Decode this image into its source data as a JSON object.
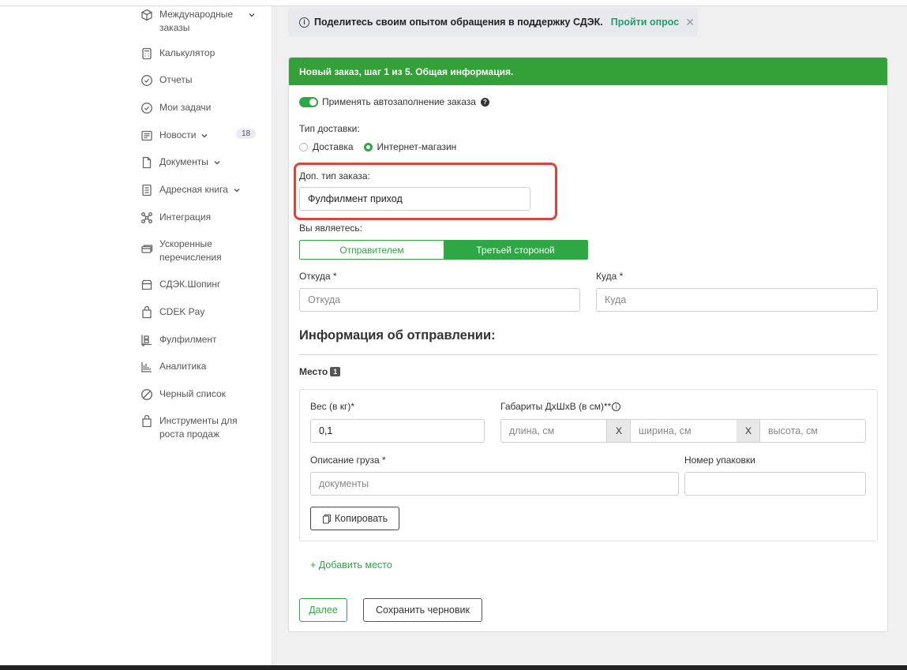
{
  "sidebar": {
    "items": [
      {
        "label": "Международные заказы",
        "icon": "box-icon",
        "has_chevron": true
      },
      {
        "label": "Калькулятор",
        "icon": "calculator-icon"
      },
      {
        "label": "Отчеты",
        "icon": "check-circle-icon"
      },
      {
        "label": "Мои задачи",
        "icon": "check-circle-icon"
      },
      {
        "label": "Новости",
        "icon": "news-icon",
        "has_chevron": true,
        "badge": "18"
      },
      {
        "label": "Документы",
        "icon": "document-icon",
        "has_chevron": true
      },
      {
        "label": "Адресная книга",
        "icon": "address-book-icon",
        "has_chevron": true
      },
      {
        "label": "Интеграция",
        "icon": "integration-icon"
      },
      {
        "label": "Ускоренные перечисления",
        "icon": "card-icon"
      },
      {
        "label": "СДЭК.Шопинг",
        "icon": "shop-icon"
      },
      {
        "label": "CDEK Pay",
        "icon": "bag-icon"
      },
      {
        "label": "Фулфилмент",
        "icon": "fulfillment-icon"
      },
      {
        "label": "Аналитика",
        "icon": "analytics-icon"
      },
      {
        "label": "Черный список",
        "icon": "blocked-icon"
      },
      {
        "label": "Инструменты для роста продаж",
        "icon": "bag-icon"
      }
    ]
  },
  "notice": {
    "text": "Поделитесь своим опытом обращения в поддержку СДЭК.",
    "link": "Пройти опрос",
    "close": "✕"
  },
  "form": {
    "header": "Новый заказ, шаг 1 из 5. Общая информация.",
    "autofill_label": "Применять автозаполнение заказа",
    "help": "?",
    "delivery_type_label": "Тип доставки:",
    "delivery_options": [
      "Доставка",
      "Интернет-магазин"
    ],
    "delivery_selected": "Интернет-магазин",
    "extra_type_label": "Доп. тип заказа:",
    "extra_type_value": "Фулфилмент приход",
    "you_are_label": "Вы являетесь:",
    "role_options": [
      "Отправителем",
      "Третьей стороной"
    ],
    "role_selected": "Третьей стороной",
    "from_label": "Откуда *",
    "from_placeholder": "Откуда",
    "to_label": "Куда *",
    "to_placeholder": "Куда",
    "shipment_title": "Информация об отправлении:",
    "place_label": "Место",
    "place_number": "1",
    "weight_label": "Вес (в кг)*",
    "weight_value": "0,1",
    "dims_label": "Габариты ДхШхВ (в см)**",
    "length_placeholder": "длина, см",
    "width_placeholder": "ширина, см",
    "height_placeholder": "высота, см",
    "dims_sep": "X",
    "cargo_label": "Описание груза *",
    "cargo_value": "документы",
    "package_label": "Номер упаковки",
    "copy_button": "Копировать",
    "add_place": "+ Добавить место",
    "next_button": "Далее",
    "save_draft_button": "Сохранить черновик"
  },
  "colors": {
    "accent": "#2ea844",
    "header": "#34a038",
    "highlight": "#d8453a"
  }
}
